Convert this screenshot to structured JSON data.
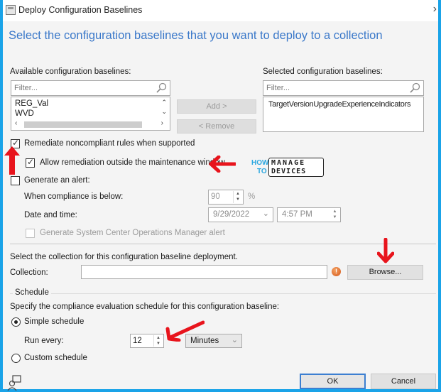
{
  "window": {
    "title": "Deploy Configuration Baselines",
    "heading": "Select the configuration baselines that you want to deploy to a collection"
  },
  "available": {
    "label": "Available configuration baselines:",
    "filter_placeholder": "Filter...",
    "items": [
      "REG_Val",
      "WVD"
    ]
  },
  "selected": {
    "label": "Selected configuration baselines:",
    "filter_placeholder": "Filter...",
    "items": [
      "TargetVersionUpgradeExperienceIndicators"
    ]
  },
  "buttons": {
    "add": "Add >",
    "remove": "< Remove",
    "browse": "Browse...",
    "ok": "OK",
    "cancel": "Cancel"
  },
  "options": {
    "remediate": {
      "label": "Remediate noncompliant rules when supported",
      "checked": true
    },
    "allow_outside_window": {
      "label": "Allow remediation outside the maintenance window",
      "checked": true
    },
    "generate_alert": {
      "label": "Generate an alert:",
      "checked": false
    },
    "compliance_below_label": "When compliance is below:",
    "compliance_value": "90",
    "percent_sign": "%",
    "date_time_label": "Date and time:",
    "date_value": "9/29/2022",
    "time_value": "4:57 PM",
    "scom_alert": {
      "label": "Generate System Center Operations Manager alert",
      "checked": false
    }
  },
  "collection": {
    "instruction": "Select the collection for this configuration baseline deployment.",
    "label": "Collection:",
    "value": ""
  },
  "schedule": {
    "group_label": "Schedule",
    "instruction": "Specify the compliance evaluation schedule for this configuration baseline:",
    "simple_label": "Simple schedule",
    "simple_selected": true,
    "run_every_label": "Run every:",
    "run_every_value": "12",
    "unit_value": "Minutes",
    "custom_label": "Custom schedule"
  },
  "watermark": {
    "how": "HOW",
    "to": "TO",
    "manage": "MANAGE",
    "devices": "DEVICES"
  },
  "colors": {
    "heading": "#3a78c9",
    "frame": "#1aa3e8",
    "annotation_arrow": "#e8141c"
  }
}
